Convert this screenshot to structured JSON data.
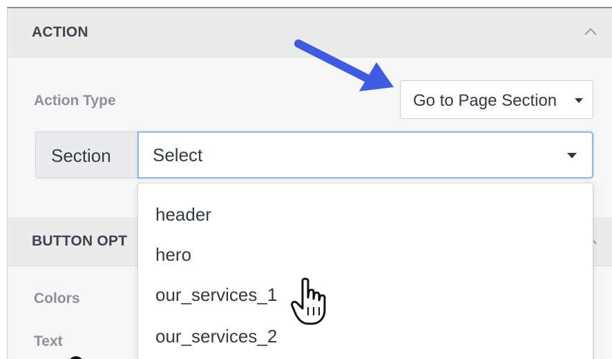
{
  "action_section": {
    "title": "ACTION",
    "action_type_label": "Action Type",
    "action_type_value": "Go to Page Section",
    "section_label": "Section",
    "section_select_value": "Select"
  },
  "button_options_section": {
    "title": "BUTTON OPT",
    "colors_label": "Colors",
    "text_label": "Text"
  },
  "dropdown": {
    "options": [
      "header",
      "hero",
      "our_services_1",
      "our_services_2"
    ]
  },
  "colors": {
    "annotation_arrow": "#3f5be0",
    "select_focus_border": "#8fb8e6"
  },
  "icons": {
    "collapse": "chevron-up-icon",
    "cursor": "hand-pointer-icon",
    "annotation": "arrow-annotation-icon"
  }
}
